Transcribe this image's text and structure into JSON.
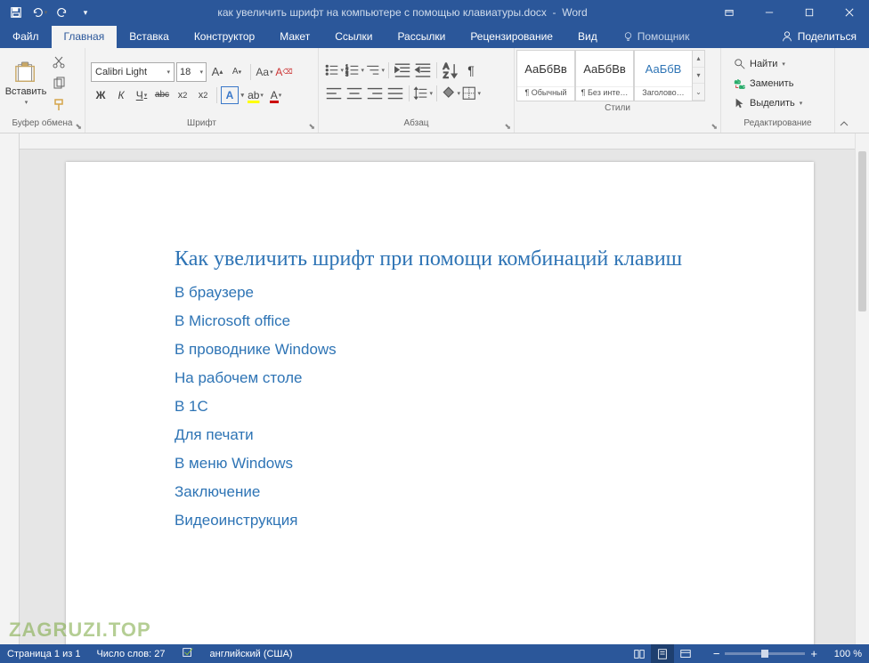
{
  "titlebar": {
    "doc_title": "как увеличить шрифт на компьютере с помощью клавиатуры.docx",
    "app_name": "Word"
  },
  "tabs": {
    "file": "Файл",
    "home": "Главная",
    "insert": "Вставка",
    "design": "Конструктор",
    "layout": "Макет",
    "references": "Ссылки",
    "mailings": "Рассылки",
    "review": "Рецензирование",
    "view": "Вид",
    "tell_me": "Помощник",
    "share": "Поделиться"
  },
  "ribbon": {
    "clipboard": {
      "label": "Буфер обмена",
      "paste": "Вставить"
    },
    "font": {
      "label": "Шрифт",
      "name": "Calibri Light",
      "size": "18",
      "bold": "Ж",
      "italic": "К",
      "underline": "Ч",
      "strike": "abc",
      "sub": "x₂",
      "sup": "x²",
      "casebtn": "Aa",
      "clear": "A",
      "effects": "A",
      "highlight": "ab",
      "color": "A"
    },
    "paragraph": {
      "label": "Абзац"
    },
    "styles": {
      "label": "Стили",
      "preview": "АаБбВв",
      "preview_head": "АаБбВ",
      "normal": "¶ Обычный",
      "nospace": "¶ Без инте…",
      "heading1": "Заголово…"
    },
    "editing": {
      "label": "Редактирование",
      "find": "Найти",
      "replace": "Заменить",
      "select": "Выделить"
    }
  },
  "document": {
    "heading": "Как увеличить шрифт при помощи комбинаций клавиш",
    "items": [
      "В браузере",
      "В Microsoft office",
      "В проводнике Windows",
      "На рабочем столе",
      "В 1С",
      "Для печати",
      "В меню Windows",
      "Заключение",
      "Видеоинструкция"
    ]
  },
  "statusbar": {
    "page": "Страница 1 из 1",
    "words": "Число слов: 27",
    "lang": "английский (США)",
    "zoom": "100 %"
  },
  "watermark": "ZAGRUZI.TOP"
}
